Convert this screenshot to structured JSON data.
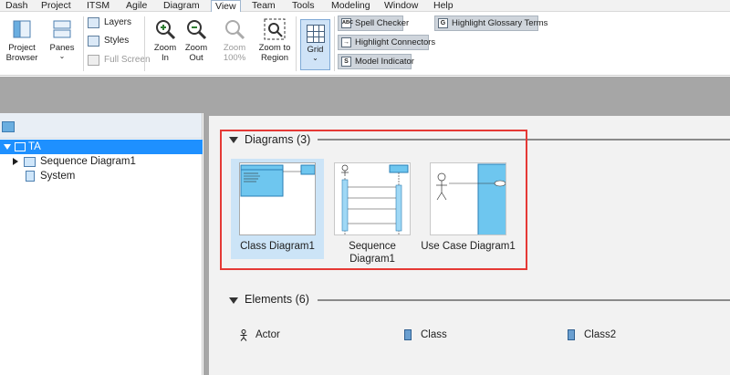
{
  "menu": [
    {
      "label": "Dash",
      "active": false
    },
    {
      "label": "Project",
      "active": false
    },
    {
      "label": "ITSM",
      "active": false
    },
    {
      "label": "Agile",
      "active": false
    },
    {
      "label": "Diagram",
      "active": false
    },
    {
      "label": "View",
      "active": true
    },
    {
      "label": "Team",
      "active": false
    },
    {
      "label": "Tools",
      "active": false
    },
    {
      "label": "Modeling",
      "active": false
    },
    {
      "label": "Window",
      "active": false
    },
    {
      "label": "Help",
      "active": false
    }
  ],
  "ribbon": {
    "project_browser": "Project\nBrowser",
    "panes": "Panes",
    "layers": "Layers",
    "styles": "Styles",
    "full_screen": "Full Screen",
    "zoom_in": "Zoom\nIn",
    "zoom_out": "Zoom\nOut",
    "zoom_100": "Zoom\n100%",
    "zoom_to_region": "Zoom to\nRegion",
    "grid": "Grid",
    "spell_checker": "Spell Checker",
    "highlight_glossary_terms": "Highlight Glossary Terms",
    "highlight_connectors": "Highlight Connectors",
    "model_indicator": "Model Indicator"
  },
  "tree": {
    "root": "TA",
    "items": [
      "Sequence Diagram1",
      "System"
    ]
  },
  "diagrams_section": {
    "title": "Diagrams (3)",
    "items": [
      {
        "label": "Class Diagram1",
        "selected": true
      },
      {
        "label": "Sequence\nDiagram1",
        "selected": false
      },
      {
        "label": "Use Case Diagram1",
        "selected": false
      }
    ]
  },
  "elements_section": {
    "title": "Elements (6)",
    "items": [
      {
        "label": "Actor",
        "icon": "actor-icon"
      },
      {
        "label": "Class",
        "icon": "class-icon"
      },
      {
        "label": "Class2",
        "icon": "class-icon"
      }
    ]
  },
  "colors": {
    "selection": "#1e90ff",
    "highlight_box": "#e53935",
    "diagram_selected": "#cce4f7"
  }
}
